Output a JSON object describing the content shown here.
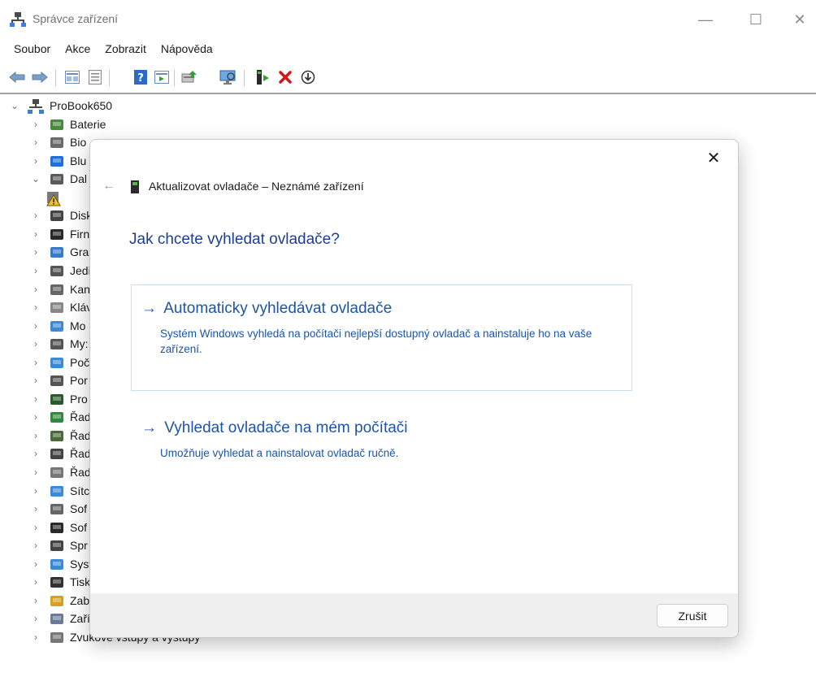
{
  "window": {
    "title": "Správce zařízení",
    "controls": {
      "minimize": "—",
      "maximize": "☐",
      "close": "✕"
    }
  },
  "menubar": {
    "items": [
      "Soubor",
      "Akce",
      "Zobrazit",
      "Nápověda"
    ]
  },
  "toolbar": {
    "buttons": [
      "back-icon",
      "forward-icon",
      "properties-icon",
      "list-icon",
      "help-icon",
      "action-icon",
      "update-driver-icon",
      "scan-hardware-icon",
      "enable-device-icon",
      "uninstall-icon",
      "download-icon"
    ]
  },
  "tree": {
    "root": {
      "label": "ProBook650",
      "expanded": true
    },
    "items": [
      {
        "label": "Baterie",
        "expanded": false
      },
      {
        "label": "Bio",
        "expanded": false
      },
      {
        "label": "Blu",
        "expanded": false
      },
      {
        "label": "Dal",
        "expanded": true
      },
      {
        "label": "",
        "child": true,
        "icon": "warning-device-icon"
      },
      {
        "label": "Disk",
        "expanded": false
      },
      {
        "label": "Firn",
        "expanded": false
      },
      {
        "label": "Gra",
        "expanded": false
      },
      {
        "label": "Jedi",
        "expanded": false
      },
      {
        "label": "Kan",
        "expanded": false
      },
      {
        "label": "Kláv",
        "expanded": false
      },
      {
        "label": "Mo",
        "expanded": false
      },
      {
        "label": "My:",
        "expanded": false
      },
      {
        "label": "Poč",
        "expanded": false
      },
      {
        "label": "Por",
        "expanded": false
      },
      {
        "label": "Pro",
        "expanded": false
      },
      {
        "label": "Řad",
        "expanded": false
      },
      {
        "label": "Řad",
        "expanded": false
      },
      {
        "label": "Řad",
        "expanded": false
      },
      {
        "label": "Řad",
        "expanded": false
      },
      {
        "label": "Sítc",
        "expanded": false
      },
      {
        "label": "Sof",
        "expanded": false
      },
      {
        "label": "Sof",
        "expanded": false
      },
      {
        "label": "Spr",
        "expanded": false
      },
      {
        "label": "Syst",
        "expanded": false
      },
      {
        "label": "Tisk",
        "expanded": false
      },
      {
        "label": "Zab",
        "expanded": false
      },
      {
        "label": "Zařízení standardu HID",
        "expanded": false
      },
      {
        "label": "Zvukové vstupy a výstupy",
        "expanded": false
      }
    ]
  },
  "dialog": {
    "close_glyph": "✕",
    "back_glyph": "←",
    "header": "Aktualizovat ovladače – Neznámé zařízení",
    "question": "Jak chcete vyhledat ovladače?",
    "options": [
      {
        "arrow": "→",
        "title": "Automaticky vyhledávat ovladače",
        "description": "Systém Windows vyhledá na počítači nejlepší dostupný ovladač a nainstaluje ho na vaše zařízení."
      },
      {
        "arrow": "→",
        "title": "Vyhledat ovladače na mém počítači",
        "description": "Umožňuje vyhledat a nainstalovat ovladač ručně."
      }
    ],
    "cancel_label": "Zrušit"
  },
  "colors": {
    "link_blue": "#1c55a8",
    "heading_blue": "#1c3f94",
    "option_border": "#c7dff0",
    "footer_bg": "#f0f0f0"
  }
}
